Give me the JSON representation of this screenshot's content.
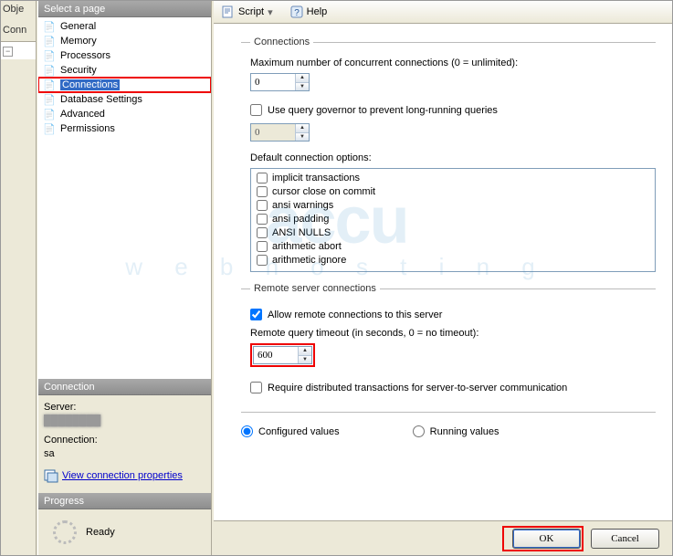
{
  "obj": {
    "title": "Obje",
    "conn": "Conn"
  },
  "sidebar": {
    "header": "Select a page",
    "items": [
      {
        "label": "General"
      },
      {
        "label": "Memory"
      },
      {
        "label": "Processors"
      },
      {
        "label": "Security"
      },
      {
        "label": "Connections"
      },
      {
        "label": "Database Settings"
      },
      {
        "label": "Advanced"
      },
      {
        "label": "Permissions"
      }
    ]
  },
  "connPanel": {
    "header": "Connection",
    "serverLabel": "Server:",
    "connectionLabel": "Connection:",
    "connectionValue": "sa",
    "viewPropsLink": "View connection properties"
  },
  "progressPanel": {
    "header": "Progress",
    "status": "Ready"
  },
  "toolbar": {
    "script": "Script",
    "help": "Help"
  },
  "form": {
    "group1": "Connections",
    "maxConnLabel": "Maximum number of concurrent connections (0 = unlimited):",
    "maxConnValue": "0",
    "useGovernor": "Use query governor to prevent long-running queries",
    "governorValue": "0",
    "defaultOptsLabel": "Default connection options:",
    "options": [
      "implicit transactions",
      "cursor close on commit",
      "ansi warnings",
      "ansi padding",
      "ANSI NULLS",
      "arithmetic abort",
      "arithmetic ignore"
    ],
    "group2": "Remote server connections",
    "allowRemote": "Allow remote connections to this server",
    "remoteTimeoutLabel": "Remote query timeout (in seconds, 0 = no timeout):",
    "remoteTimeoutValue": "600",
    "requireDist": "Require distributed transactions for server-to-server communication",
    "configuredLabel": "Configured values",
    "runningLabel": "Running values"
  },
  "buttons": {
    "ok": "OK",
    "cancel": "Cancel"
  },
  "watermark": {
    "main": "accu",
    "sub": "w e b h o s t i n g"
  }
}
